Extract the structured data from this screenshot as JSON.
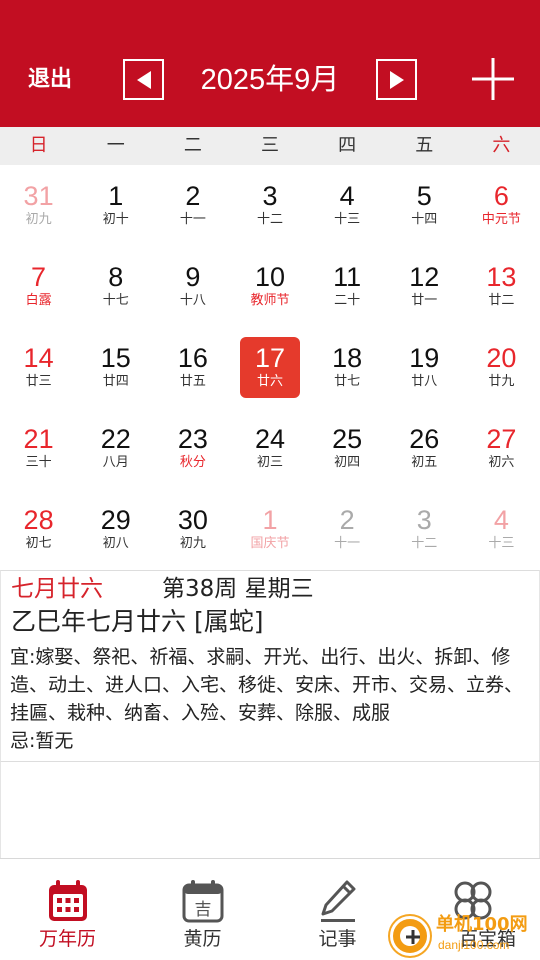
{
  "header": {
    "exit_label": "退出",
    "month_title": "2025年9月",
    "background": "#c20e22"
  },
  "weekdays": [
    "日",
    "一",
    "二",
    "三",
    "四",
    "五",
    "六"
  ],
  "calendar": {
    "days": [
      {
        "day": "31",
        "lunar": "初九",
        "other": true,
        "red": true,
        "red_lunar": false
      },
      {
        "day": "1",
        "lunar": "初十",
        "other": false,
        "red": false,
        "red_lunar": false
      },
      {
        "day": "2",
        "lunar": "十一",
        "other": false,
        "red": false,
        "red_lunar": false
      },
      {
        "day": "3",
        "lunar": "十二",
        "other": false,
        "red": false,
        "red_lunar": false
      },
      {
        "day": "4",
        "lunar": "十三",
        "other": false,
        "red": false,
        "red_lunar": false
      },
      {
        "day": "5",
        "lunar": "十四",
        "other": false,
        "red": false,
        "red_lunar": false
      },
      {
        "day": "6",
        "lunar": "中元节",
        "other": false,
        "red": true,
        "red_lunar": true
      },
      {
        "day": "7",
        "lunar": "白露",
        "other": false,
        "red": true,
        "red_lunar": true
      },
      {
        "day": "8",
        "lunar": "十七",
        "other": false,
        "red": false,
        "red_lunar": false
      },
      {
        "day": "9",
        "lunar": "十八",
        "other": false,
        "red": false,
        "red_lunar": false
      },
      {
        "day": "10",
        "lunar": "教师节",
        "other": false,
        "red": false,
        "red_lunar": true
      },
      {
        "day": "11",
        "lunar": "二十",
        "other": false,
        "red": false,
        "red_lunar": false
      },
      {
        "day": "12",
        "lunar": "廿一",
        "other": false,
        "red": false,
        "red_lunar": false
      },
      {
        "day": "13",
        "lunar": "廿二",
        "other": false,
        "red": true,
        "red_lunar": false
      },
      {
        "day": "14",
        "lunar": "廿三",
        "other": false,
        "red": true,
        "red_lunar": false
      },
      {
        "day": "15",
        "lunar": "廿四",
        "other": false,
        "red": false,
        "red_lunar": false
      },
      {
        "day": "16",
        "lunar": "廿五",
        "other": false,
        "red": false,
        "red_lunar": false
      },
      {
        "day": "17",
        "lunar": "廿六",
        "other": false,
        "red": false,
        "red_lunar": false,
        "selected": true
      },
      {
        "day": "18",
        "lunar": "廿七",
        "other": false,
        "red": false,
        "red_lunar": false
      },
      {
        "day": "19",
        "lunar": "廿八",
        "other": false,
        "red": false,
        "red_lunar": false
      },
      {
        "day": "20",
        "lunar": "廿九",
        "other": false,
        "red": true,
        "red_lunar": false
      },
      {
        "day": "21",
        "lunar": "三十",
        "other": false,
        "red": true,
        "red_lunar": false
      },
      {
        "day": "22",
        "lunar": "八月",
        "other": false,
        "red": false,
        "red_lunar": false
      },
      {
        "day": "23",
        "lunar": "秋分",
        "other": false,
        "red": false,
        "red_lunar": true
      },
      {
        "day": "24",
        "lunar": "初三",
        "other": false,
        "red": false,
        "red_lunar": false
      },
      {
        "day": "25",
        "lunar": "初四",
        "other": false,
        "red": false,
        "red_lunar": false
      },
      {
        "day": "26",
        "lunar": "初五",
        "other": false,
        "red": false,
        "red_lunar": false
      },
      {
        "day": "27",
        "lunar": "初六",
        "other": false,
        "red": true,
        "red_lunar": false
      },
      {
        "day": "28",
        "lunar": "初七",
        "other": false,
        "red": true,
        "red_lunar": false
      },
      {
        "day": "29",
        "lunar": "初八",
        "other": false,
        "red": false,
        "red_lunar": false
      },
      {
        "day": "30",
        "lunar": "初九",
        "other": false,
        "red": false,
        "red_lunar": false
      },
      {
        "day": "1",
        "lunar": "国庆节",
        "other": true,
        "red": true,
        "red_lunar": true
      },
      {
        "day": "2",
        "lunar": "十一",
        "other": true,
        "red": false,
        "red_lunar": false
      },
      {
        "day": "3",
        "lunar": "十二",
        "other": true,
        "red": false,
        "red_lunar": false
      },
      {
        "day": "4",
        "lunar": "十三",
        "other": true,
        "red": true,
        "red_lunar": false
      }
    ]
  },
  "detail": {
    "lunar_date": "七月廿六",
    "week_info": "第38周 星期三",
    "ganzhi": "乙巳年七月廿六 [属蛇]",
    "yi": "宜:嫁娶、祭祀、祈福、求嗣、开光、出行、出火、拆卸、修造、动土、进人口、入宅、移徙、安床、开市、交易、立券、挂匾、栽种、纳畜、入殓、安葬、除服、成服",
    "ji": "忌:暂无"
  },
  "bottom_nav": {
    "tabs": [
      {
        "label": "万年历",
        "icon": "calendar-grid-icon",
        "active": true
      },
      {
        "label": "黄历",
        "icon": "almanac-icon",
        "active": false
      },
      {
        "label": "记事",
        "icon": "pen-icon",
        "active": false
      },
      {
        "label": "百宝箱",
        "icon": "clover-icon",
        "active": false
      }
    ]
  },
  "watermark": {
    "text": "单机100网",
    "url": "danji100.com"
  },
  "colors": {
    "brand_red": "#c20e22",
    "holiday_red": "#e8262c",
    "selected_bg": "#e53a2c"
  }
}
